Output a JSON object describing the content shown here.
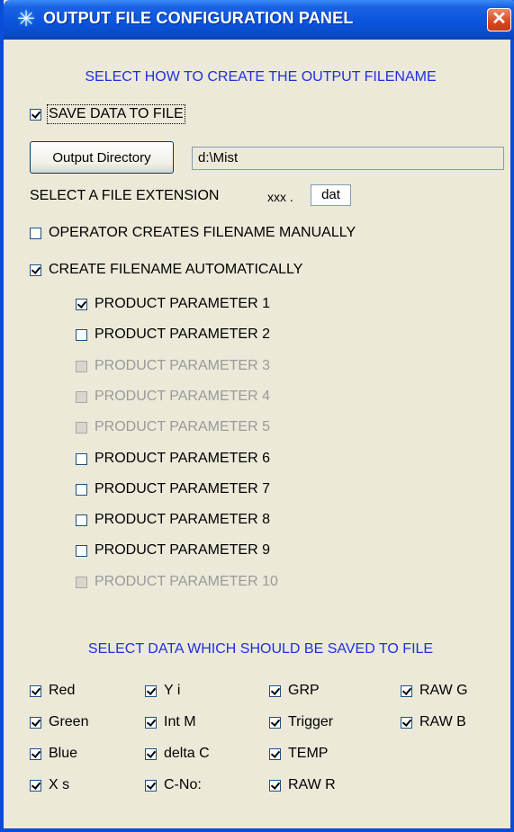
{
  "window": {
    "title": "OUTPUT FILE CONFIGURATION PANEL",
    "title_icon": "star-burst-icon",
    "close_glyph": "✕"
  },
  "filename_section": {
    "heading": "SELECT HOW TO CREATE THE OUTPUT FILENAME",
    "save_data": {
      "label": "SAVE DATA TO FILE",
      "checked": true
    },
    "output_directory_button": "Output Directory",
    "output_directory_value": "d:\\Mist",
    "extension_label": "SELECT A FILE EXTENSION",
    "extension_prefix": "xxx .",
    "extension_value": "dat",
    "manual": {
      "label": "OPERATOR CREATES FILENAME MANUALLY",
      "checked": false
    },
    "automatic": {
      "label": "CREATE FILENAME AUTOMATICALLY",
      "checked": true
    },
    "product_parameters": [
      {
        "label": "PRODUCT PARAMETER 1",
        "checked": true,
        "enabled": true
      },
      {
        "label": "PRODUCT PARAMETER 2",
        "checked": false,
        "enabled": true
      },
      {
        "label": "PRODUCT PARAMETER 3",
        "checked": false,
        "enabled": false
      },
      {
        "label": "PRODUCT PARAMETER 4",
        "checked": false,
        "enabled": false
      },
      {
        "label": "PRODUCT PARAMETER 5",
        "checked": false,
        "enabled": false
      },
      {
        "label": "PRODUCT PARAMETER 6",
        "checked": false,
        "enabled": true
      },
      {
        "label": "PRODUCT PARAMETER 7",
        "checked": false,
        "enabled": true
      },
      {
        "label": "PRODUCT PARAMETER 8",
        "checked": false,
        "enabled": true
      },
      {
        "label": "PRODUCT PARAMETER 9",
        "checked": false,
        "enabled": true
      },
      {
        "label": "PRODUCT PARAMETER 10",
        "checked": false,
        "enabled": false
      }
    ]
  },
  "data_section": {
    "heading": "SELECT DATA WHICH SHOULD BE SAVED TO FILE",
    "columns": [
      [
        {
          "label": "Red",
          "checked": true
        },
        {
          "label": "Green",
          "checked": true
        },
        {
          "label": "Blue",
          "checked": true
        },
        {
          "label": "X s",
          "checked": true
        }
      ],
      [
        {
          "label": "Y i",
          "checked": true
        },
        {
          "label": "Int M",
          "checked": true
        },
        {
          "label": "delta C",
          "checked": true
        },
        {
          "label": "C-No:",
          "checked": true
        }
      ],
      [
        {
          "label": "GRP",
          "checked": true
        },
        {
          "label": "Trigger",
          "checked": true
        },
        {
          "label": "TEMP",
          "checked": true
        },
        {
          "label": "RAW R",
          "checked": true
        }
      ],
      [
        {
          "label": "RAW G",
          "checked": true
        },
        {
          "label": "RAW B",
          "checked": true
        }
      ]
    ]
  },
  "colors": {
    "titlebar": "#0A4DD8",
    "heading_text": "#1F2FE0",
    "panel_background": "#ECE9D8",
    "disabled_text": "#9A9A9A",
    "close_button": "#D9471E"
  }
}
